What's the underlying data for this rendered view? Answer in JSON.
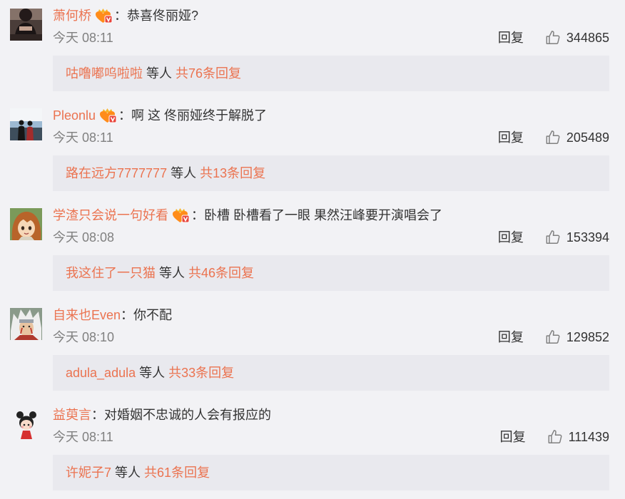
{
  "labels": {
    "separator": "：",
    "reply": "回复",
    "etc": "等人"
  },
  "icons": {
    "badge": "vip-badge-icon",
    "like": "thumbs-up-icon"
  },
  "colors": {
    "page_background": "#f2f2f5",
    "reply_box_background": "#e9e9ee",
    "username": "#eb7350",
    "text": "#333333",
    "meta": "#808080"
  },
  "comments": [
    {
      "username": "萧何桥",
      "badge": "vip-badge-icon",
      "text": "恭喜佟丽娅?",
      "time": "今天 08:11",
      "likes": 344865,
      "reply_users": "咕噜嘟呜啦啦",
      "reply_total": "共76条回复"
    },
    {
      "username": "Pleonlu",
      "badge": "vip-badge-icon",
      "text": "啊 这 佟丽娅终于解脱了",
      "time": "今天 08:11",
      "likes": 205489,
      "reply_users": "路在远方7777777",
      "reply_total": "共13条回复"
    },
    {
      "username": "学渣只会说一句好看",
      "badge": "vip-badge-icon",
      "text": "卧槽 卧槽看了一眼 果然汪峰要开演唱会了",
      "time": "今天 08:08",
      "likes": 153394,
      "reply_users": "我这住了一只猫",
      "reply_total": "共46条回复"
    },
    {
      "username": "自来也Even",
      "text": "你不配",
      "time": "今天 08:10",
      "likes": 129852,
      "reply_users": "adula_adula",
      "reply_total": "共33条回复"
    },
    {
      "username": "益萸言",
      "text": "对婚姻不忠诚的人会有报应的",
      "time": "今天 08:11",
      "likes": 111439,
      "reply_users": "许妮子7",
      "reply_total": "共61条回复"
    }
  ]
}
